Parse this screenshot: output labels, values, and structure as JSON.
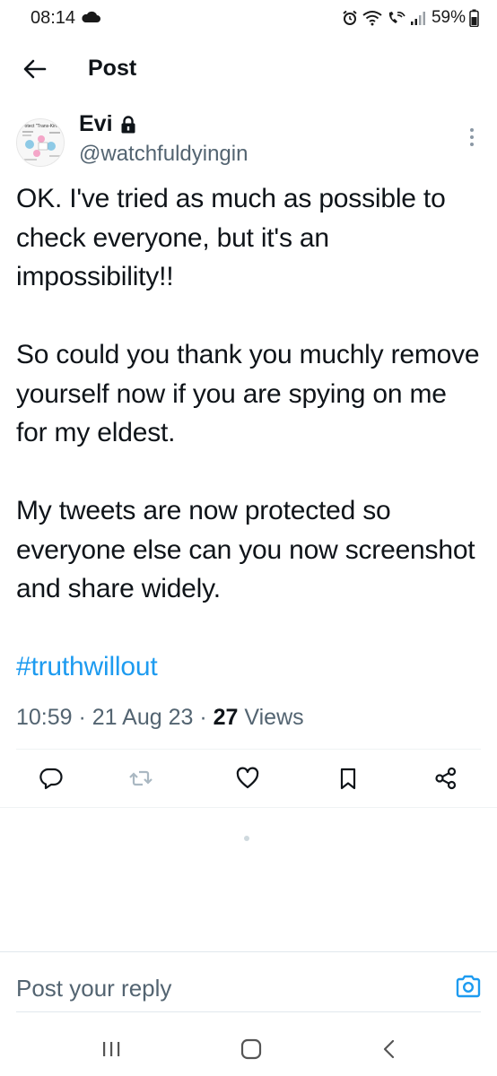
{
  "status_bar": {
    "time": "08:14",
    "battery": "59%",
    "icons": [
      "cloud-icon",
      "alarm-icon",
      "wifi-icon",
      "wifi-call-icon",
      "signal-icon",
      "battery-icon"
    ]
  },
  "header": {
    "title": "Post",
    "back_icon": "arrow-left-icon"
  },
  "author": {
    "name": "Evi",
    "handle": "@watchfuldyingin",
    "protected_icon": "lock-icon",
    "avatar_caption": "otect \"Trans-Kin."
  },
  "tweet": {
    "paragraph_1": "OK. I've tried as much as possible to check everyone, but it's an impossibility!!",
    "paragraph_2": "So could you thank you muchly remove yourself now if you are spying on me for my eldest.",
    "paragraph_3": "My tweets are now protected so everyone else can you now screenshot and share widely.",
    "hashtag": "#truthwillout"
  },
  "meta": {
    "time": "10:59",
    "separator": " · ",
    "date": "21 Aug 23",
    "views_count": "27",
    "views_label": " Views"
  },
  "actions": [
    {
      "name": "reply",
      "icon": "comment-icon"
    },
    {
      "name": "repost",
      "icon": "repost-icon",
      "disabled": true
    },
    {
      "name": "like",
      "icon": "heart-icon"
    },
    {
      "name": "bookmark",
      "icon": "bookmark-icon"
    },
    {
      "name": "share",
      "icon": "share-icon"
    }
  ],
  "reply": {
    "placeholder": "Post your reply",
    "camera_icon": "camera-icon"
  },
  "nav_bar": {
    "icons": [
      "recent-apps-icon",
      "home-icon",
      "back-icon"
    ]
  },
  "colors": {
    "text": "#0f1419",
    "secondary": "#536471",
    "accent": "#1d9bf0",
    "divider": "#eff3f4"
  }
}
